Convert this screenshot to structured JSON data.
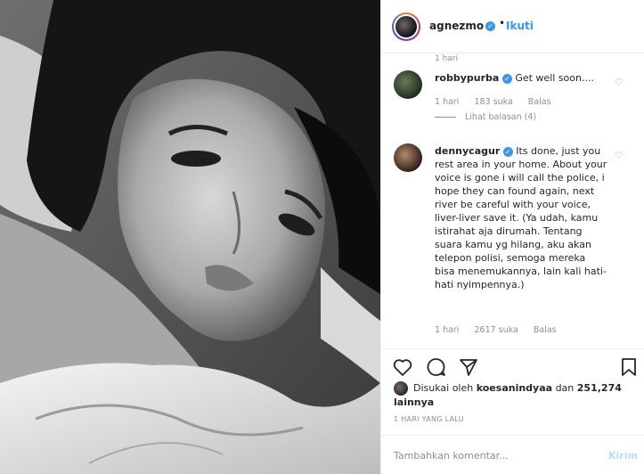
{
  "post": {
    "username": "agnezmo",
    "dot": "•",
    "follow_label": "Ikuti"
  },
  "comments": {
    "caption_time": "1 hari",
    "items": [
      {
        "username": "robbypurba",
        "text": "Get well soon....",
        "time": "1 hari",
        "likes": "183 suka",
        "reply_label": "Balas",
        "view_replies": "Lihat balasan (4)"
      },
      {
        "username": "dennycagur",
        "text": "Its done, just you rest area in your home. About your voice is gone i will call the police, i hope they can found again, next river be careful with your voice, liver-liver save it. (Ya udah, kamu istirahat aja dirumah. Tentang suara kamu yg hilang, aku akan telepon polisi, semoga mereka bisa menemukannya, lain kali hati-hati nyimpennya.)",
        "time": "1 hari",
        "likes": "2617 suka",
        "reply_label": "Balas"
      }
    ]
  },
  "likes": {
    "prefix": "Disukai oleh",
    "user": "koesanindyaa",
    "and": "dan",
    "count": "251,274 lainnya"
  },
  "timestamp": "1 HARI YANG LALU",
  "add_comment": {
    "placeholder": "Tambahkan komentar...",
    "post_label": "Kirim"
  },
  "icons": {
    "like": "heart-icon",
    "comment": "comment-icon",
    "share": "share-icon",
    "save": "bookmark-icon",
    "verified": "verified-badge-icon"
  },
  "colors": {
    "accent": "#3897f0",
    "muted": "#8e8e8e",
    "post_disabled": "#b2dffc"
  }
}
